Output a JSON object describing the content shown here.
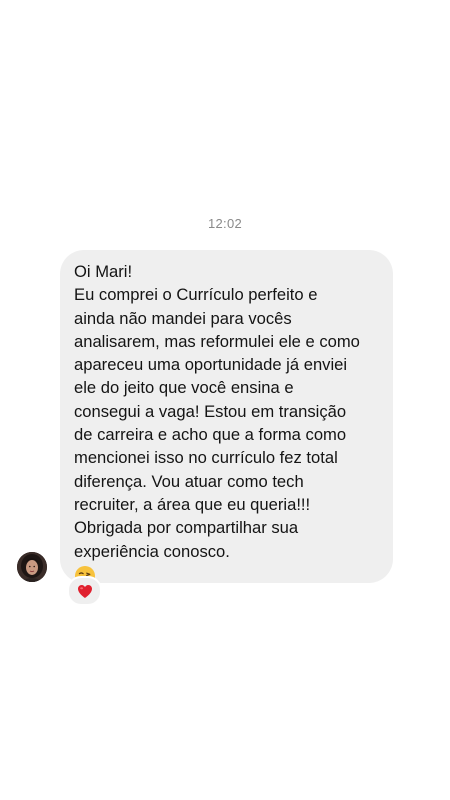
{
  "conversation": {
    "timestamp": "12:02",
    "message": {
      "lines": [
        "Oi Mari!",
        "Eu comprei o Currículo perfeito e",
        "ainda não mandei para vocês",
        "analisarem, mas reformulei ele e como",
        "apareceu uma oportunidade já enviei",
        "ele do jeito que você ensina e",
        "consegui a vaga! Estou em transição",
        "de carreira e acho que a forma como",
        "mencionei isso no currículo fez total",
        "diferença. Vou atuar como tech",
        "recruiter, a área que eu queria!!!",
        "Obrigada por compartilhar sua",
        "experiência conosco."
      ],
      "emoji": "kissing-face-with-heart-emoji",
      "reaction": "red-heart-emoji"
    },
    "sender_avatar": "avatar-photo"
  },
  "colors": {
    "bubble": "#efefef",
    "timestamp": "#8a8a8a",
    "text": "#141414",
    "heart": "#e0202e"
  }
}
